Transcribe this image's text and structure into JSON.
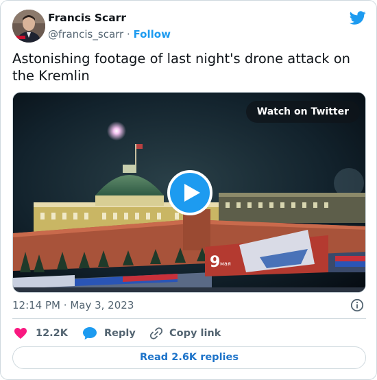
{
  "author": {
    "display_name": "Francis Scarr",
    "handle": "@francis_scarr",
    "separator": "·",
    "follow_label": "Follow"
  },
  "tweet": {
    "text": "Astonishing footage of last night's drone attack on the Kremlin"
  },
  "media": {
    "watch_label": "Watch on Twitter",
    "banner_number": "9",
    "banner_text": "мая"
  },
  "meta": {
    "time": "12:14 PM",
    "separator": "·",
    "date": "May 3, 2023"
  },
  "actions": {
    "likes": "12.2K",
    "reply_label": "Reply",
    "copy_label": "Copy link"
  },
  "read_replies_label": "Read 2.6K replies",
  "colors": {
    "accent": "#1d9bf0",
    "like": "#f91880",
    "text_secondary": "#536471",
    "border": "#cfd9de"
  },
  "icons": [
    "twitter-bird-icon",
    "play-icon",
    "info-icon",
    "heart-icon",
    "speech-bubble-icon",
    "link-icon"
  ]
}
